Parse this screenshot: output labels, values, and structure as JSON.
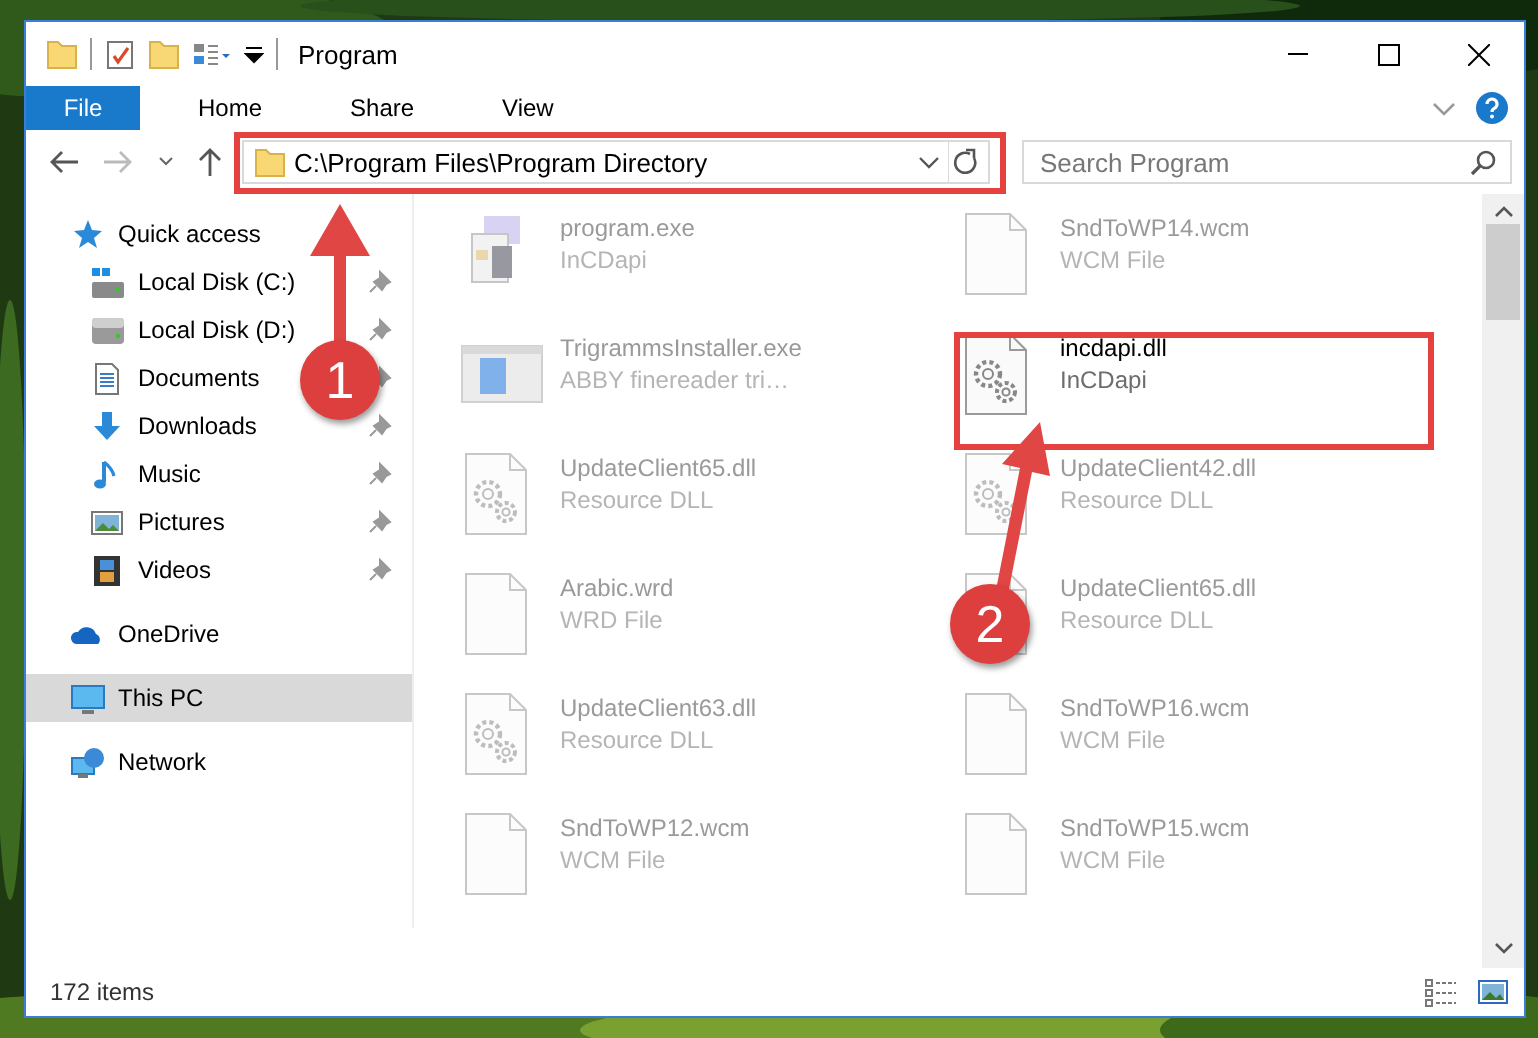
{
  "window": {
    "title": "Program"
  },
  "ribbon": {
    "tabs": [
      {
        "label": "File",
        "kind": "file-menu",
        "selected": false
      },
      {
        "label": "Home",
        "kind": "tab",
        "selected": false
      },
      {
        "label": "Share",
        "kind": "tab",
        "selected": false
      },
      {
        "label": "View",
        "kind": "tab",
        "selected": false
      }
    ]
  },
  "address": {
    "path": "C:\\Program Files\\Program Directory"
  },
  "search": {
    "placeholder": "Search Program"
  },
  "nav": {
    "items": [
      {
        "label": "Quick access",
        "kind": "quick-access",
        "pinned": false,
        "selected": false,
        "children": [
          {
            "label": "Local Disk (C:)",
            "kind": "system-drive",
            "pinned": true,
            "selected": false
          },
          {
            "label": "Local Disk (D:)",
            "kind": "drive",
            "pinned": true,
            "selected": false
          },
          {
            "label": "Documents",
            "kind": "documents",
            "pinned": true,
            "selected": false
          },
          {
            "label": "Downloads",
            "kind": "downloads",
            "pinned": true,
            "selected": false
          },
          {
            "label": "Music",
            "kind": "music",
            "pinned": true,
            "selected": false
          },
          {
            "label": "Pictures",
            "kind": "pictures",
            "pinned": true,
            "selected": false
          },
          {
            "label": "Videos",
            "kind": "videos",
            "pinned": true,
            "selected": false
          }
        ]
      },
      {
        "label": "OneDrive",
        "kind": "cloud",
        "pinned": false,
        "selected": false
      },
      {
        "label": "This PC",
        "kind": "computer",
        "pinned": false,
        "selected": true
      },
      {
        "label": "Network",
        "kind": "network",
        "pinned": false,
        "selected": false
      }
    ]
  },
  "files": [
    {
      "name": "program.exe",
      "type": "InCDapi",
      "kind": "program",
      "highlighted": false
    },
    {
      "name": "SndToWP14.wcm",
      "type": "WCM File",
      "kind": "blank",
      "highlighted": false
    },
    {
      "name": "TrigrammsInstaller.exe",
      "type": "ABBY finereader tri…",
      "kind": "installer",
      "highlighted": false
    },
    {
      "name": "incdapi.dll",
      "type": "InCDapi",
      "kind": "dll",
      "highlighted": true
    },
    {
      "name": "UpdateClient65.dll",
      "type": "Resource DLL",
      "kind": "dll",
      "highlighted": false
    },
    {
      "name": "UpdateClient42.dll",
      "type": "Resource DLL",
      "kind": "dll",
      "highlighted": false
    },
    {
      "name": "Arabic.wrd",
      "type": "WRD File",
      "kind": "blank",
      "highlighted": false
    },
    {
      "name": "UpdateClient65.dll",
      "type": "Resource DLL",
      "kind": "dll",
      "highlighted": false
    },
    {
      "name": "UpdateClient63.dll",
      "type": "Resource DLL",
      "kind": "dll",
      "highlighted": false
    },
    {
      "name": "SndToWP16.wcm",
      "type": "WCM File",
      "kind": "blank",
      "highlighted": false
    },
    {
      "name": "SndToWP12.wcm",
      "type": "WCM File",
      "kind": "blank",
      "highlighted": false
    },
    {
      "name": "SndToWP15.wcm",
      "type": "WCM File",
      "kind": "blank",
      "highlighted": false
    }
  ],
  "status_bar": {
    "item_count": "172 items"
  },
  "callouts": [
    {
      "number": "1",
      "kind": "address"
    },
    {
      "number": "2",
      "kind": "file"
    }
  ]
}
